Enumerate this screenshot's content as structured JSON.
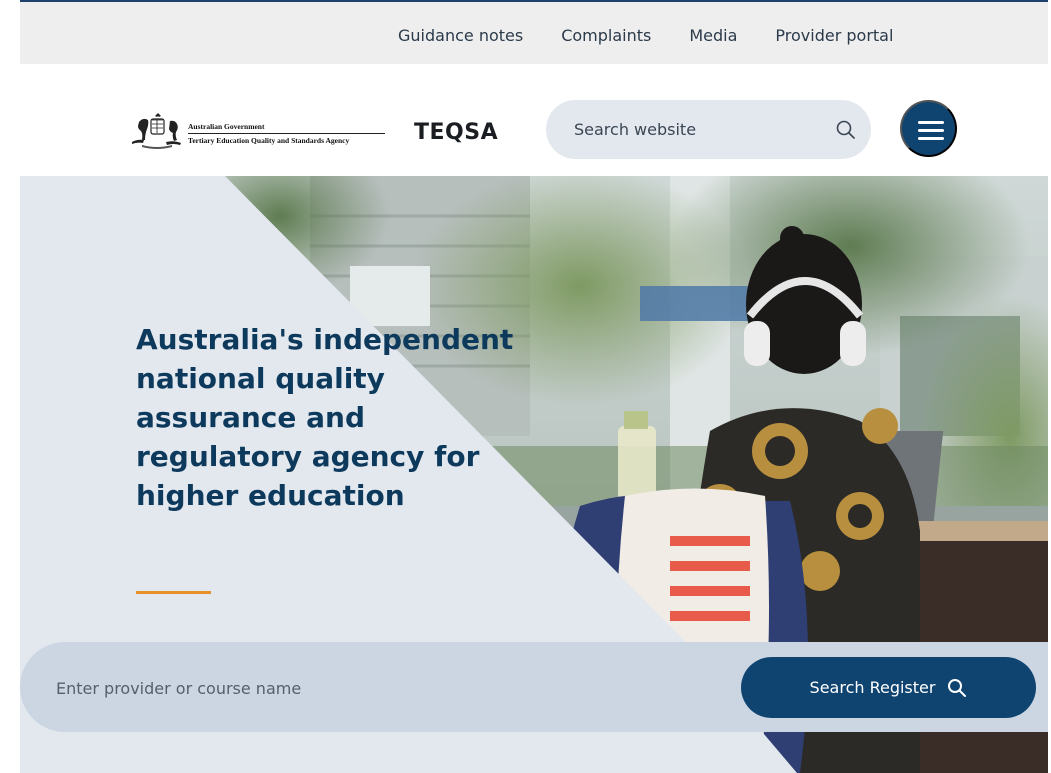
{
  "utility_nav": {
    "items": [
      {
        "label": "Guidance notes"
      },
      {
        "label": "Complaints"
      },
      {
        "label": "Media"
      },
      {
        "label": "Provider portal"
      }
    ]
  },
  "header": {
    "gov_line1": "Australian Government",
    "gov_line2": "Tertiary Education Quality and Standards Agency",
    "brand": "TEQSA",
    "search_placeholder": "Search website",
    "search_icon": "search-icon",
    "menu_icon": "hamburger-menu-icon"
  },
  "hero": {
    "title": "Australia's independent national quality assurance and regulatory agency for higher education",
    "accent_color": "#e8912a"
  },
  "register": {
    "placeholder": "Enter provider or course name",
    "button_label": "Search Register",
    "button_icon": "search-icon"
  },
  "colors": {
    "navy": "#0f4471",
    "panel": "#e3e8ef",
    "utility_bg": "#eeeeee"
  }
}
